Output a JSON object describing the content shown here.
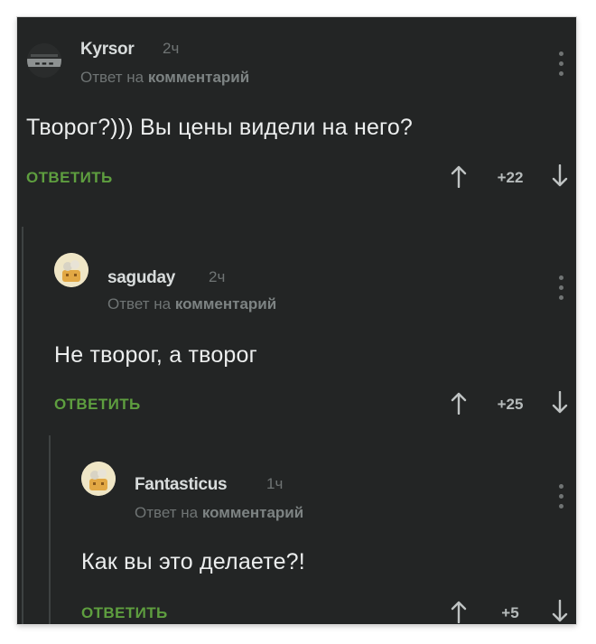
{
  "colors": {
    "background": "#232525",
    "accent_green": "#5e9e3f",
    "muted_text": "#6f7474",
    "body_text": "#eceeee"
  },
  "comments": [
    {
      "username": "Kyrsor",
      "time": "2ч",
      "reply_prefix": "Ответ на",
      "reply_target": "комментарий",
      "text": "Творог?))) Вы цены видели на него?",
      "reply_label": "ОТВЕТИТЬ",
      "score": "+22",
      "avatar_icon": "dark-photo-avatar-icon",
      "menu_icon": "vertical-dots-icon",
      "upvote_icon": "arrow-up-icon",
      "downvote_icon": "arrow-down-icon"
    },
    {
      "username": "saguday",
      "time": "2ч",
      "reply_prefix": "Ответ на",
      "reply_target": "комментарий",
      "text": "Не творог, а творог",
      "reply_label": "ОТВЕТИТЬ",
      "score": "+25",
      "avatar_icon": "default-cartoon-avatar-icon",
      "menu_icon": "vertical-dots-icon",
      "upvote_icon": "arrow-up-icon",
      "downvote_icon": "arrow-down-icon"
    },
    {
      "username": "Fantasticus",
      "time": "1ч",
      "reply_prefix": "Ответ на",
      "reply_target": "комментарий",
      "text": "Как вы это делаете?!",
      "reply_label": "ОТВЕТИТЬ",
      "score": "+5",
      "avatar_icon": "default-cartoon-avatar-icon",
      "menu_icon": "vertical-dots-icon",
      "upvote_icon": "arrow-up-icon",
      "downvote_icon": "arrow-down-icon"
    }
  ]
}
